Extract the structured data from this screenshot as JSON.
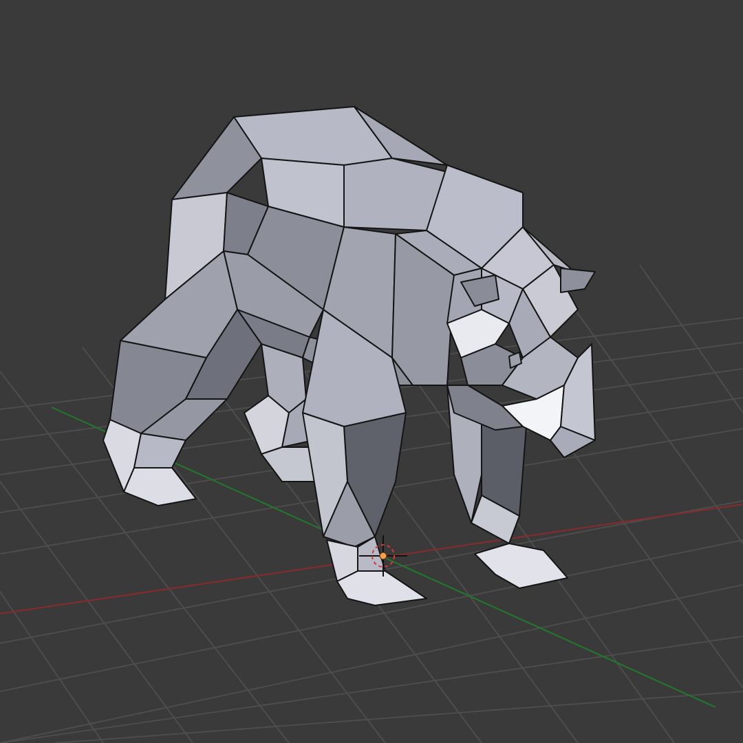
{
  "viewport": {
    "background": "#3a3a3a",
    "grid": {
      "visible": true,
      "line_color": "#4d4d4d"
    },
    "axes": {
      "x_axis_color": "#8a2b2b",
      "y_axis_color": "#1f7a2a"
    },
    "mesh": {
      "object": "low-poly bear",
      "wireframe_color": "#141414",
      "light_face": "#e6e7ee",
      "mid_face": "#a9abb6",
      "dark_face": "#6b6d78"
    },
    "cursor_3d": {
      "ring_color": "#d23a3a",
      "center_color": "#f0a050",
      "cross_color": "#111111"
    }
  }
}
